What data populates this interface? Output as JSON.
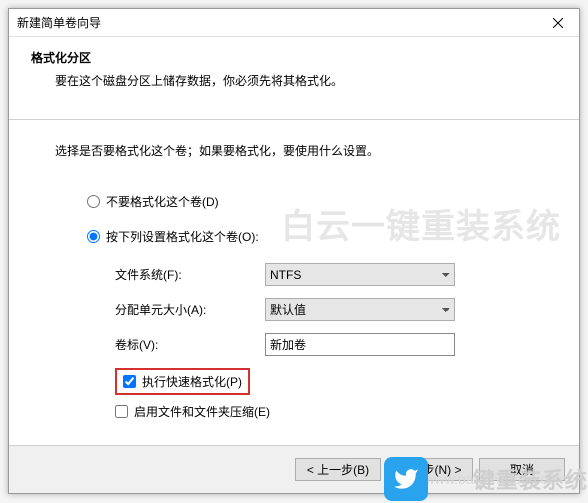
{
  "window": {
    "title": "新建简单卷向导"
  },
  "header": {
    "heading": "格式化分区",
    "description": "要在这个磁盘分区上储存数据，你必须先将其格式化。"
  },
  "instruction": "选择是否要格式化这个卷；如果要格式化，要使用什么设置。",
  "options": {
    "noFormat": {
      "label": "不要格式化这个卷(D)",
      "checked": false
    },
    "formatWith": {
      "label": "按下列设置格式化这个卷(O):",
      "checked": true
    }
  },
  "fields": {
    "filesystem": {
      "label": "文件系统(F):",
      "value": "NTFS"
    },
    "allocUnit": {
      "label": "分配单元大小(A):",
      "value": "默认值"
    },
    "volumeLabel": {
      "label": "卷标(V):",
      "value": "新加卷"
    }
  },
  "checkboxes": {
    "quickFormat": {
      "label": "执行快速格式化(P)",
      "checked": true
    },
    "compression": {
      "label": "启用文件和文件夹压缩(E)",
      "checked": false
    }
  },
  "buttons": {
    "back": "< 上一步(B)",
    "next": "下一步(N) >",
    "cancel": "取消"
  },
  "watermark": {
    "big": "白云一键重装系统",
    "url": "www.baiyunxitong.com",
    "overlay": "键重装系统"
  }
}
